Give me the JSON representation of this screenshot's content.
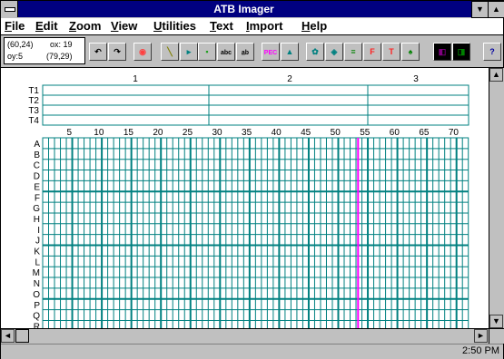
{
  "window": {
    "title": "ATB Imager"
  },
  "menu": [
    {
      "label": "File",
      "accel": "F",
      "rest": "ile"
    },
    {
      "label": "Edit",
      "accel": "E",
      "rest": "dit"
    },
    {
      "label": "Zoom",
      "accel": "Z",
      "rest": "oom"
    },
    {
      "label": "View",
      "accel": "V",
      "rest": "iew"
    },
    {
      "label": "Utilities",
      "accel": "U",
      "rest": "tilities"
    },
    {
      "label": "Text",
      "accel": "T",
      "rest": "ext"
    },
    {
      "label": "Import",
      "accel": "I",
      "rest": "mport"
    },
    {
      "label": "Help",
      "accel": "H",
      "rest": "elp"
    }
  ],
  "coords": {
    "cursor": "(60,24)",
    "ox": "ox: 19",
    "oy": "oy:5",
    "origin": "(79,29)"
  },
  "toolbar": {
    "buttons": [
      {
        "name": "undo-button",
        "icon": "undo-arrow-icon",
        "glyph": "↶"
      },
      {
        "name": "redo-button",
        "icon": "redo-arrow-icon",
        "glyph": "↷"
      },
      {
        "name": "record-button",
        "icon": "record-icon",
        "glyph": "◉"
      },
      {
        "name": "line-tool-button",
        "icon": "line-pen-icon",
        "glyph": "╲"
      },
      {
        "name": "select-tool-button",
        "icon": "cursor-select-icon",
        "glyph": "▸"
      },
      {
        "name": "fill-tool-button",
        "icon": "fill-icon",
        "glyph": "▪"
      },
      {
        "name": "text-abc-button",
        "icon": "text-icon",
        "glyph": "abc"
      },
      {
        "name": "vertical-text-button",
        "icon": "vertical-text-icon",
        "glyph": "a̲b"
      },
      {
        "name": "pec-button",
        "icon": "pec-icon",
        "glyph": "PEC"
      },
      {
        "name": "landscape-button",
        "icon": "landscape-icon",
        "glyph": "▲"
      },
      {
        "name": "pattern-button",
        "icon": "pattern-icon",
        "glyph": "✿"
      },
      {
        "name": "image-button",
        "icon": "image-icon",
        "glyph": "◈"
      },
      {
        "name": "align-button",
        "icon": "align-icon",
        "glyph": "≡"
      },
      {
        "name": "font-button",
        "icon": "font-icon",
        "glyph": "F"
      },
      {
        "name": "font-size-button",
        "icon": "font-size-icon",
        "glyph": "T"
      },
      {
        "name": "stamp-button",
        "icon": "stamp-icon",
        "glyph": "♠"
      },
      {
        "name": "palette-button",
        "icon": "palette-icon",
        "glyph": "◧"
      },
      {
        "name": "palette-alt-button",
        "icon": "palette-alt-icon",
        "glyph": "◨"
      },
      {
        "name": "help-button",
        "icon": "help-question-icon",
        "glyph": "?"
      }
    ]
  },
  "top_grid": {
    "rows": [
      "T1",
      "T2",
      "T3",
      "T4"
    ],
    "column_numbers": [
      "1",
      "2",
      "3"
    ]
  },
  "main_grid": {
    "rows": [
      "A",
      "B",
      "C",
      "D",
      "E",
      "F",
      "G",
      "H",
      "I",
      "J",
      "K",
      "L",
      "M",
      "N",
      "O",
      "P",
      "Q",
      "R"
    ],
    "column_numbers": [
      "5",
      "10",
      "15",
      "20",
      "25",
      "30",
      "35",
      "40",
      "45",
      "50",
      "55",
      "60",
      "65",
      "70"
    ],
    "total_columns": 72,
    "cursor_column": 53
  },
  "colors": {
    "grid": "#008080",
    "cursor_line": "#ff00ff",
    "titlebar": "#000080"
  },
  "status": {
    "time": "2:50 PM"
  }
}
